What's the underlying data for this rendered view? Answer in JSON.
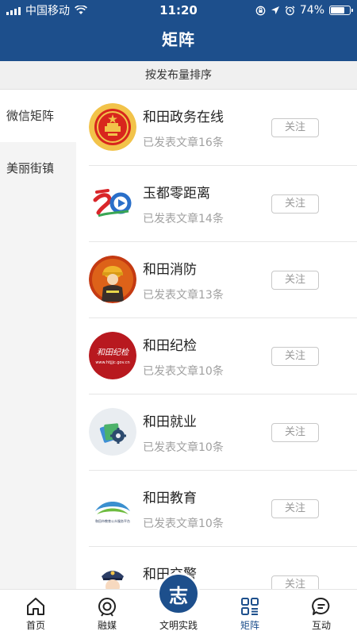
{
  "status": {
    "carrier": "中国移动",
    "time": "11:20",
    "battery": "74%",
    "battery_level": 0.74
  },
  "header": {
    "title": "矩阵"
  },
  "sort": {
    "label": "按发布量排序"
  },
  "sidebar": {
    "items": [
      {
        "label": "微信矩阵"
      },
      {
        "label": "美丽街镇"
      }
    ]
  },
  "accounts": [
    {
      "name": "和田政务在线",
      "count": "已发表文章16条",
      "follow": "关注"
    },
    {
      "name": "玉都零距离",
      "count": "已发表文章14条",
      "follow": "关注"
    },
    {
      "name": "和田消防",
      "count": "已发表文章13条",
      "follow": "关注"
    },
    {
      "name": "和田纪检",
      "count": "已发表文章10条",
      "follow": "关注"
    },
    {
      "name": "和田就业",
      "count": "已发表文章10条",
      "follow": "关注"
    },
    {
      "name": "和田教育",
      "count": "已发表文章10条",
      "follow": "关注"
    },
    {
      "name": "和田交警",
      "count": "",
      "follow": "关注"
    }
  ],
  "logos": {
    "jijian_text": "和田纪检",
    "jijian_url": "www.htjjjc.gov.cn",
    "jiaoyu_caption": "和田市教育公众服务平台"
  },
  "tabs": [
    {
      "label": "首页"
    },
    {
      "label": "融媒"
    },
    {
      "label": "文明实践",
      "badge": "志"
    },
    {
      "label": "矩阵"
    },
    {
      "label": "互动"
    }
  ],
  "colors": {
    "primary": "#1d4f8c"
  }
}
